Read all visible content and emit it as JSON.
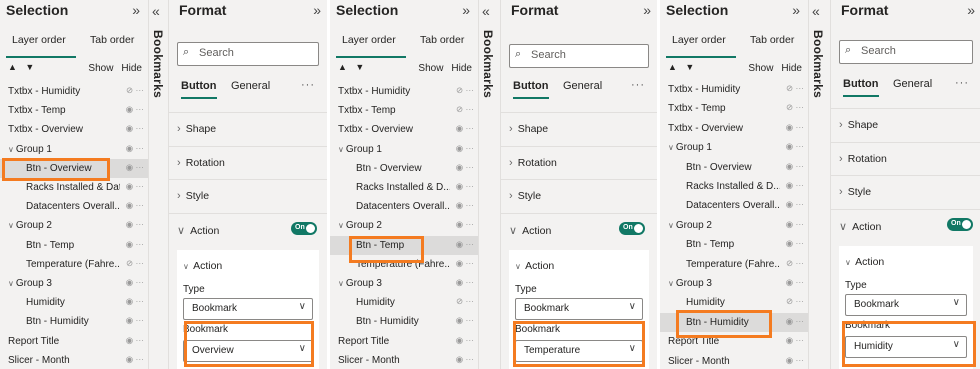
{
  "common": {
    "selection_title": "Selection",
    "format_title": "Format",
    "bookmarks_label": "Bookmarks",
    "collapse_chevron": "»",
    "expand_chevron": "«",
    "tab_layer_order": "Layer order",
    "tab_order": "Tab order",
    "up_down_arrows": "▲ ▼",
    "show_label": "Show",
    "hide_label": "Hide",
    "search_placeholder": "Search",
    "subtab_button": "Button",
    "subtab_general": "General",
    "more_dots": "···",
    "section_shape": "Shape",
    "section_rotation": "Rotation",
    "section_style": "Style",
    "section_action": "Action",
    "toggle_on": "On",
    "card_action": "Action",
    "type_label": "Type",
    "type_value": "Bookmark",
    "bookmark_label": "Bookmark",
    "highlight_color": "#f47b20",
    "accent_color": "#117865"
  },
  "panels": [
    {
      "layers": [
        {
          "label": "Txtbx - Humidity",
          "indent": 0,
          "group": false,
          "hidden": true
        },
        {
          "label": "Txtbx - Temp",
          "indent": 0,
          "group": false,
          "hidden": false
        },
        {
          "label": "Txtbx - Overview",
          "indent": 0,
          "group": false,
          "hidden": false
        },
        {
          "label": "Group 1",
          "indent": 0,
          "group": true,
          "hidden": false
        },
        {
          "label": "Btn - Overview",
          "indent": 1,
          "group": false,
          "hidden": false,
          "selected": true
        },
        {
          "label": "Racks Installed & Dat...",
          "indent": 1,
          "group": false,
          "hidden": false
        },
        {
          "label": "Datacenters Overall...",
          "indent": 1,
          "group": false,
          "hidden": false
        },
        {
          "label": "Group 2",
          "indent": 0,
          "group": true,
          "hidden": false
        },
        {
          "label": "Btn - Temp",
          "indent": 1,
          "group": false,
          "hidden": false
        },
        {
          "label": "Temperature (Fahre...",
          "indent": 1,
          "group": false,
          "hidden": true
        },
        {
          "label": "Group 3",
          "indent": 0,
          "group": true,
          "hidden": false
        },
        {
          "label": "Humidity",
          "indent": 1,
          "group": false,
          "hidden": false
        },
        {
          "label": "Btn - Humidity",
          "indent": 1,
          "group": false,
          "hidden": false
        },
        {
          "label": "Report Title",
          "indent": 0,
          "group": false,
          "hidden": false
        },
        {
          "label": "Slicer - Month",
          "indent": 0,
          "group": false,
          "hidden": false
        }
      ],
      "bookmark_value": "Overview"
    },
    {
      "layers": [
        {
          "label": "Txtbx - Humidity",
          "indent": 0,
          "group": false,
          "hidden": true
        },
        {
          "label": "Txtbx - Temp",
          "indent": 0,
          "group": false,
          "hidden": true
        },
        {
          "label": "Txtbx - Overview",
          "indent": 0,
          "group": false,
          "hidden": false
        },
        {
          "label": "Group 1",
          "indent": 0,
          "group": true,
          "hidden": false
        },
        {
          "label": "Btn - Overview",
          "indent": 1,
          "group": false,
          "hidden": false
        },
        {
          "label": "Racks Installed & D...",
          "indent": 1,
          "group": false,
          "hidden": false
        },
        {
          "label": "Datacenters Overall...",
          "indent": 1,
          "group": false,
          "hidden": false
        },
        {
          "label": "Group 2",
          "indent": 0,
          "group": true,
          "hidden": false
        },
        {
          "label": "Btn - Temp",
          "indent": 1,
          "group": false,
          "hidden": false,
          "selected": true
        },
        {
          "label": "Temperature (Fahre...",
          "indent": 1,
          "group": false,
          "hidden": false
        },
        {
          "label": "Group 3",
          "indent": 0,
          "group": true,
          "hidden": false
        },
        {
          "label": "Humidity",
          "indent": 1,
          "group": false,
          "hidden": true
        },
        {
          "label": "Btn - Humidity",
          "indent": 1,
          "group": false,
          "hidden": false
        },
        {
          "label": "Report Title",
          "indent": 0,
          "group": false,
          "hidden": false
        },
        {
          "label": "Slicer - Month",
          "indent": 0,
          "group": false,
          "hidden": false
        }
      ],
      "bookmark_value": "Temperature"
    },
    {
      "layers": [
        {
          "label": "Txtbx - Humidity",
          "indent": 0,
          "group": false,
          "hidden": true
        },
        {
          "label": "Txtbx - Temp",
          "indent": 0,
          "group": false,
          "hidden": true
        },
        {
          "label": "Txtbx - Overview",
          "indent": 0,
          "group": false,
          "hidden": false
        },
        {
          "label": "Group 1",
          "indent": 0,
          "group": true,
          "hidden": false
        },
        {
          "label": "Btn - Overview",
          "indent": 1,
          "group": false,
          "hidden": false
        },
        {
          "label": "Racks Installed & D...",
          "indent": 1,
          "group": false,
          "hidden": false
        },
        {
          "label": "Datacenters Overall...",
          "indent": 1,
          "group": false,
          "hidden": false
        },
        {
          "label": "Group 2",
          "indent": 0,
          "group": true,
          "hidden": false
        },
        {
          "label": "Btn - Temp",
          "indent": 1,
          "group": false,
          "hidden": false
        },
        {
          "label": "Temperature (Fahre...",
          "indent": 1,
          "group": false,
          "hidden": true
        },
        {
          "label": "Group 3",
          "indent": 0,
          "group": true,
          "hidden": false
        },
        {
          "label": "Humidity",
          "indent": 1,
          "group": false,
          "hidden": true
        },
        {
          "label": "Btn - Humidity",
          "indent": 1,
          "group": false,
          "hidden": false,
          "selected": true
        },
        {
          "label": "Report Title",
          "indent": 0,
          "group": false,
          "hidden": false
        },
        {
          "label": "Slicer - Month",
          "indent": 0,
          "group": false,
          "hidden": false
        }
      ],
      "bookmark_value": "Humidity"
    }
  ]
}
